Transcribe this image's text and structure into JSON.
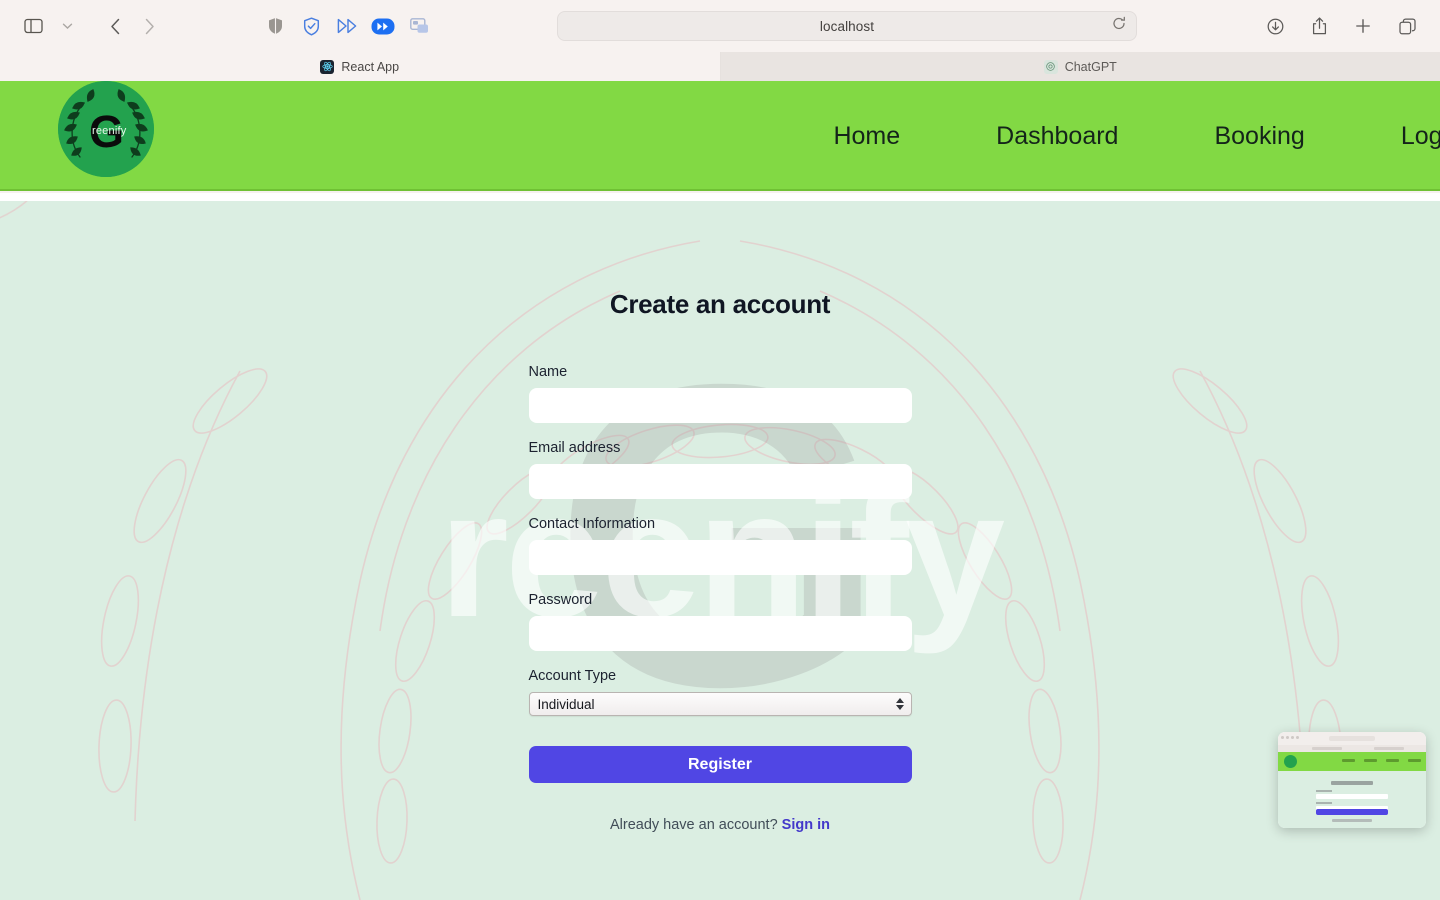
{
  "browser": {
    "url": "localhost",
    "toolbar_left": [
      {
        "name": "sidebar-toggle-icon",
        "label": "Sidebar"
      },
      {
        "name": "sidebar-options-chevron-icon",
        "label": "Sidebar options"
      },
      {
        "name": "back-icon",
        "label": "Back"
      },
      {
        "name": "forward-icon",
        "label": "Forward"
      }
    ],
    "toolbar_extensions": [
      {
        "name": "shield-icon",
        "label": "Privacy shield"
      },
      {
        "name": "shield-check-icon",
        "label": "Ad blocker"
      },
      {
        "name": "fast-forward-outline-icon",
        "label": "Skip"
      },
      {
        "name": "fast-forward-filled-icon",
        "label": "Speed"
      },
      {
        "name": "picture-in-picture-icon",
        "label": "Picture in picture"
      }
    ],
    "toolbar_right": [
      {
        "name": "downloads-icon",
        "label": "Downloads"
      },
      {
        "name": "share-icon",
        "label": "Share"
      },
      {
        "name": "new-tab-icon",
        "label": "New Tab"
      },
      {
        "name": "tab-overview-icon",
        "label": "Tab Overview"
      }
    ],
    "reload_icon": "reload-icon",
    "tabs": [
      {
        "title": "React App",
        "favicon": "react-logo-icon",
        "active": true
      },
      {
        "title": "ChatGPT",
        "favicon": "chatgpt-logo-icon",
        "active": false
      }
    ]
  },
  "site": {
    "brand": {
      "name": "Greenify",
      "initial": "G",
      "suffix": "reenify",
      "badge_color": "#23a24e",
      "header_color": "#82d944"
    },
    "nav": [
      {
        "label": "Home"
      },
      {
        "label": "Dashboard"
      },
      {
        "label": "Booking"
      },
      {
        "label": "Login"
      }
    ]
  },
  "page": {
    "title": "Create an account",
    "watermark_text": "reenify",
    "watermark_letter": "G",
    "fields": [
      {
        "label": "Name",
        "value": "",
        "placeholder": "",
        "type": "text",
        "name": "name-field"
      },
      {
        "label": "Email address",
        "value": "",
        "placeholder": "",
        "type": "email",
        "name": "email-field"
      },
      {
        "label": "Contact Information",
        "value": "",
        "placeholder": "",
        "type": "text",
        "name": "contact-field"
      },
      {
        "label": "Password",
        "value": "",
        "placeholder": "",
        "type": "password",
        "name": "password-field"
      }
    ],
    "account_type": {
      "label": "Account Type",
      "selected": "Individual",
      "options": [
        "Individual"
      ]
    },
    "submit_label": "Register",
    "footer_text": "Already have an account?",
    "footer_link": "Sign in",
    "accent_color": "#5046e4",
    "background_color": "#dbeee2"
  }
}
